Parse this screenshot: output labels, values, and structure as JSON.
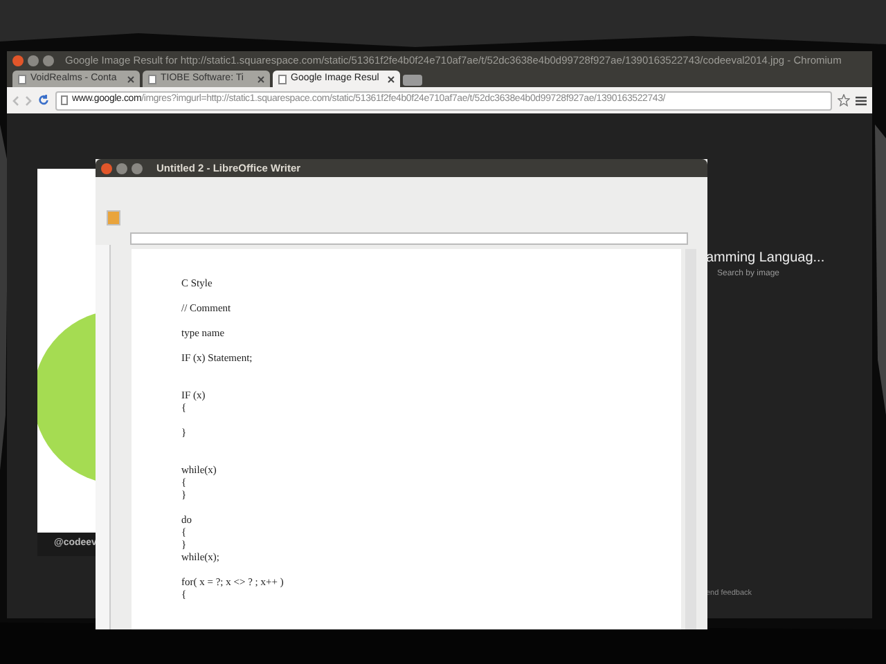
{
  "browser": {
    "title": "Google Image Result for http://static1.squarespace.com/static/51361f2fe4b0f24e710af7ae/t/52dc3638e4b0d99728f927ae/1390163522743/codeeval2014.jpg - Chromium",
    "tabs": [
      {
        "label": "VoidRealms - Conta",
        "selected": false
      },
      {
        "label": "TIOBE Software: Ti",
        "selected": false
      },
      {
        "label": "Google Image Resul",
        "selected": true
      }
    ],
    "url": {
      "host": "www.google.com",
      "path": "/imgres?imgurl=http://static1.squarespace.com/static/51361f2fe4b0f24e710af7ae/t/52dc3638e4b0d99728f927ae/1390163522743/"
    },
    "image_caption": "@codeev",
    "result_title": "amming Languag...",
    "search_by_image": "Search by image",
    "feedback": "end feedback"
  },
  "writer": {
    "title": "Untitled 2 - LibreOffice Writer",
    "blocks": [
      {
        "lines": [
          "C Style"
        ],
        "kind": "normal"
      },
      {
        "lines": [
          "// Comment"
        ],
        "kind": "normal"
      },
      {
        "lines": [
          "type name"
        ],
        "kind": "normal"
      },
      {
        "lines": [
          "IF (x) Statement;"
        ],
        "kind": "spaced"
      },
      {
        "lines": [
          "IF (x)",
          "{"
        ],
        "kind": "normal"
      },
      {
        "lines": [
          "}"
        ],
        "kind": "spaced"
      },
      {
        "lines": [
          "while(x)",
          "{",
          "}"
        ],
        "kind": "normal"
      },
      {
        "lines": [
          "do",
          "{",
          "}",
          "while(x);"
        ],
        "kind": "normal"
      },
      {
        "lines": [
          "for( x = ?; x <> ? ; x++ )",
          "{"
        ],
        "kind": "normal"
      }
    ]
  }
}
